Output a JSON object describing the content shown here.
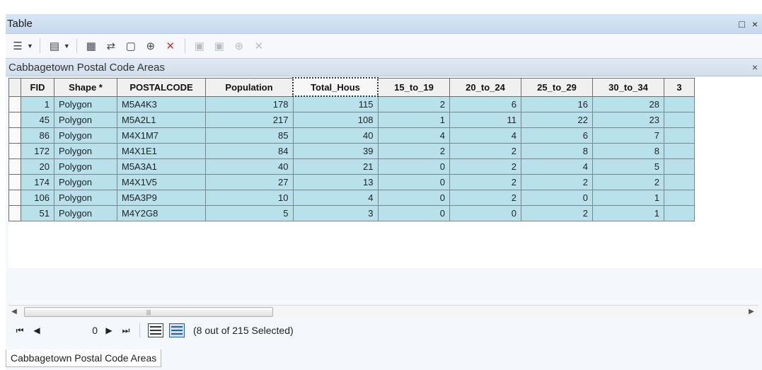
{
  "window": {
    "title": "Table",
    "maximize_glyph": "□",
    "close_glyph": "×"
  },
  "tab": {
    "title": "Cabbagetown Postal Code Areas",
    "close_glyph": "×"
  },
  "table": {
    "columns": [
      "FID",
      "Shape *",
      "POSTALCODE",
      "Population",
      "Total_Hous",
      "15_to_19",
      "20_to_24",
      "25_to_29",
      "30_to_34",
      "3"
    ],
    "rows": [
      [
        "1",
        "Polygon",
        "M5A4K3",
        "178",
        "115",
        "2",
        "6",
        "16",
        "28"
      ],
      [
        "45",
        "Polygon",
        "M5A2L1",
        "217",
        "108",
        "1",
        "11",
        "22",
        "23"
      ],
      [
        "86",
        "Polygon",
        "M4X1M7",
        "85",
        "40",
        "4",
        "4",
        "6",
        "7"
      ],
      [
        "172",
        "Polygon",
        "M4X1E1",
        "84",
        "39",
        "2",
        "2",
        "8",
        "8"
      ],
      [
        "20",
        "Polygon",
        "M5A3A1",
        "40",
        "21",
        "0",
        "2",
        "4",
        "5"
      ],
      [
        "174",
        "Polygon",
        "M4X1V5",
        "27",
        "13",
        "0",
        "2",
        "2",
        "2"
      ],
      [
        "106",
        "Polygon",
        "M5A3P9",
        "10",
        "4",
        "0",
        "2",
        "0",
        "1"
      ],
      [
        "51",
        "Polygon",
        "M4Y2G8",
        "5",
        "3",
        "0",
        "0",
        "2",
        "1"
      ]
    ]
  },
  "navigation": {
    "record_value": "0",
    "status": "(8 out of 215 Selected)"
  },
  "bottom_tab": {
    "label": "Cabbagetown Postal Code Areas"
  },
  "colors": {
    "selected_row": "#b8e1ec",
    "title_bar": "#c5d8ee"
  }
}
